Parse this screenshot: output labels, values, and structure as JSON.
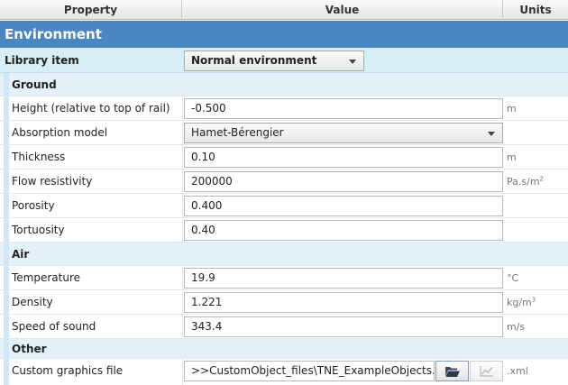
{
  "header": {
    "col_property": "Property",
    "col_value": "Value",
    "col_units": "Units"
  },
  "environment_title": "Environment",
  "library": {
    "label": "Library item",
    "selected": "Normal environment"
  },
  "ground": {
    "title": "Ground",
    "height": {
      "label": "Height (relative to top of rail)",
      "value": "-0.500",
      "unit": "m"
    },
    "absorption": {
      "label": "Absorption model",
      "value": "Hamet-Bérengier"
    },
    "thickness": {
      "label": "Thickness",
      "value": "0.10",
      "unit": "m"
    },
    "flow": {
      "label": "Flow resistivity",
      "value": "200000",
      "unit": "Pa.s/m",
      "unit_sup": "2"
    },
    "porosity": {
      "label": "Porosity",
      "value": "0.400"
    },
    "tortuosity": {
      "label": "Tortuosity",
      "value": "0.40"
    }
  },
  "air": {
    "title": "Air",
    "temperature": {
      "label": "Temperature",
      "value": "19.9",
      "unit": "°C"
    },
    "density": {
      "label": "Density",
      "value": "1.221",
      "unit": "kg/m",
      "unit_sup": "3"
    },
    "speed": {
      "label": "Speed of sound",
      "value": "343.4",
      "unit": "m/s"
    }
  },
  "other": {
    "title": "Other",
    "graphics": {
      "label": "Custom graphics file",
      "value": ">>CustomObject_files\\TNE_ExampleObjects.xml",
      "unit": ".xml"
    }
  },
  "icons": {
    "open": "folder-open-icon",
    "chart": "chart-icon",
    "dropdown": "chevron-down-icon"
  }
}
